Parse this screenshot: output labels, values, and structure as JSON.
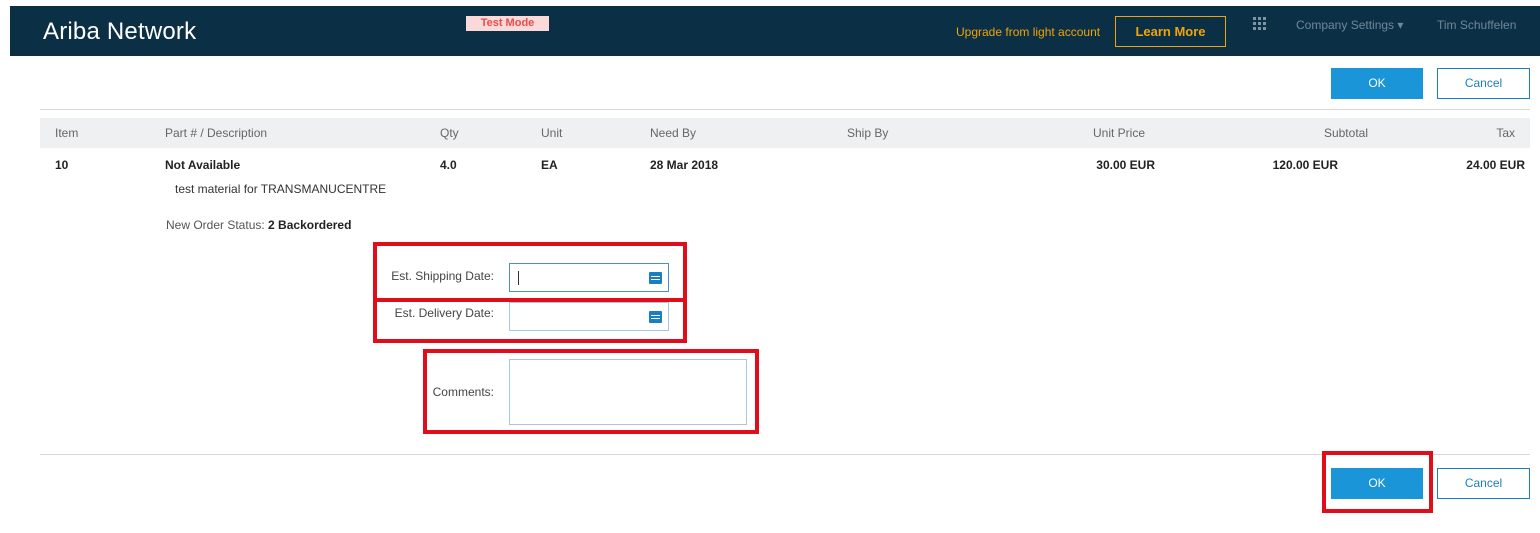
{
  "header": {
    "brand": "Ariba Network",
    "test_mode": "Test Mode",
    "upgrade_text": "Upgrade from light account",
    "learn_more": "Learn More",
    "company_settings": "Company Settings ▾",
    "user_name": "Tim Schuffelen"
  },
  "actions": {
    "ok_label": "OK",
    "cancel_label": "Cancel"
  },
  "table": {
    "columns": [
      "Item",
      "Part # / Description",
      "Qty",
      "Unit",
      "Need By",
      "Ship By",
      "Unit Price",
      "Subtotal",
      "Tax"
    ],
    "row": {
      "item": "10",
      "part": "Not Available",
      "description": "test material for TRANSMANUCENTRE",
      "qty": "4.0",
      "unit": "EA",
      "need_by": "28 Mar 2018",
      "ship_by": "",
      "unit_price": "30.00 EUR",
      "subtotal": "120.00 EUR",
      "tax": "24.00 EUR"
    }
  },
  "status": {
    "label": "New Order Status:",
    "value": "2 Backordered"
  },
  "form": {
    "shipping_label": "Est. Shipping Date:",
    "shipping_value": "",
    "delivery_label": "Est. Delivery Date:",
    "delivery_value": "",
    "comments_label": "Comments:",
    "comments_value": ""
  },
  "colors": {
    "topbar": "#0b2f45",
    "accent_orange": "#f0a30a",
    "primary_blue": "#1a95d8",
    "highlight_red": "#e00e1a"
  }
}
